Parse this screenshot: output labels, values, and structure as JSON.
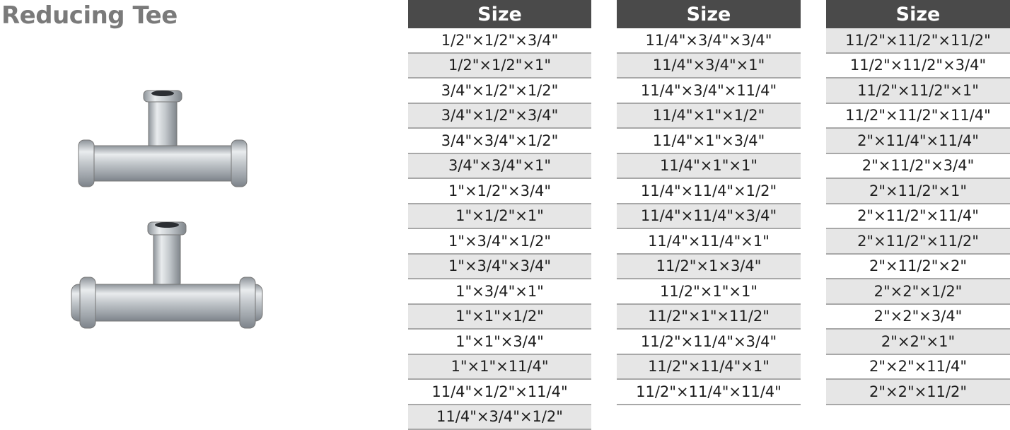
{
  "title": "Reducing Tee",
  "image": {
    "icon": "reducing-tee-fittings-photo"
  },
  "tables": [
    {
      "header": "Size",
      "rows": [
        "1/2\"×1/2\"×3/4\"",
        "1/2\"×1/2\"×1\"",
        "3/4\"×1/2\"×1/2\"",
        "3/4\"×1/2\"×3/4\"",
        "3/4\"×3/4\"×1/2\"",
        "3/4\"×3/4\"×1\"",
        "1\"×1/2\"×3/4\"",
        "1\"×1/2\"×1\"",
        "1\"×3/4\"×1/2\"",
        "1\"×3/4\"×3/4\"",
        "1\"×3/4\"×1\"",
        "1\"×1\"×1/2\"",
        "1\"×1\"×3/4\"",
        "1\"×1\"×11/4\"",
        "11/4\"×1/2\"×11/4\"",
        "11/4\"×3/4\"×1/2\""
      ]
    },
    {
      "header": "Size",
      "rows": [
        "11/4\"×3/4\"×3/4\"",
        "11/4\"×3/4\"×1\"",
        "11/4\"×3/4\"×11/4\"",
        "11/4\"×1\"×1/2\"",
        "11/4\"×1\"×3/4\"",
        "11/4\"×1\"×1\"",
        "11/4\"×11/4\"×1/2\"",
        "11/4\"×11/4\"×3/4\"",
        "11/4\"×11/4\"×1\"",
        "11/2\"×1×3/4\"",
        "11/2\"×1\"×1\"",
        "11/2\"×1\"×11/2\"",
        "11/2\"×11/4\"×3/4\"",
        "11/2\"×11/4\"×1\"",
        "11/2\"×11/4\"×11/4\""
      ]
    },
    {
      "header": "Size",
      "rows": [
        "11/2\"×11/2\"×11/2\"",
        "11/2\"×11/2\"×3/4\"",
        "11/2\"×11/2\"×1\"",
        "11/2\"×11/2\"×11/4\"",
        "2\"×11/4\"×11/4\"",
        "2\"×11/2\"×3/4\"",
        "2\"×11/2\"×1\"",
        "2\"×11/2\"×11/4\"",
        "2\"×11/2\"×11/2\"",
        "2\"×11/2\"×2\"",
        "2\"×2\"×1/2\"",
        "2\"×2\"×3/4\"",
        "2\"×2\"×1\"",
        "2\"×2\"×11/4\"",
        "2\"×2\"×11/2\""
      ]
    }
  ]
}
